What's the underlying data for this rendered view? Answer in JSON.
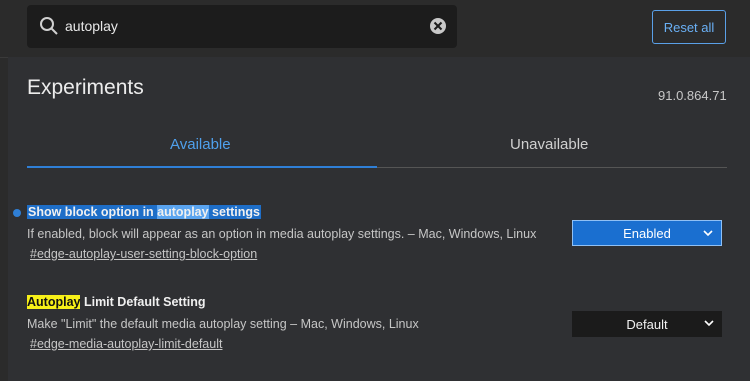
{
  "search": {
    "value": "autoplay"
  },
  "toolbar": {
    "reset_label": "Reset all"
  },
  "header": {
    "title": "Experiments",
    "version": "91.0.864.71"
  },
  "tabs": [
    {
      "label": "Available",
      "active": true
    },
    {
      "label": "Unavailable",
      "active": false
    }
  ],
  "flags": [
    {
      "name_pre": "Show block option in ",
      "name_highlight": "autoplay",
      "name_post": " settings",
      "description": "If enabled, block will appear as an option in media autoplay settings. – Mac, Windows, Linux",
      "link": "#edge-autoplay-user-setting-block-option",
      "value": "Enabled"
    },
    {
      "name_highlight": "Autoplay",
      "name_post": " Limit Default Setting",
      "description": "Make \"Limit\" the default media autoplay setting – Mac, Windows, Linux",
      "link": "#edge-media-autoplay-limit-default",
      "value": "Default"
    }
  ],
  "colors": {
    "accent": "#2f7fd6",
    "highlight_yellow": "#f7f018"
  },
  "icons": {
    "search": "search-icon",
    "clear": "clear-icon",
    "chevron": "chevron-down-icon"
  }
}
